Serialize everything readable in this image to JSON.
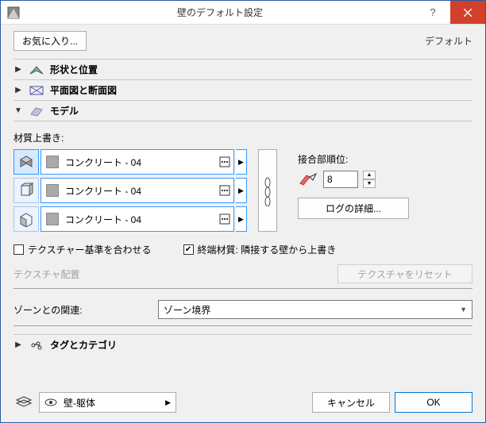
{
  "window": {
    "title": "壁のデフォルト設定"
  },
  "toprow": {
    "favorites": "お気に入り...",
    "default_label": "デフォルト"
  },
  "sections": {
    "shape": "形状と位置",
    "plan": "平面図と断面図",
    "model": "モデル",
    "tags": "タグとカテゴリ"
  },
  "model": {
    "override_label": "材質上書き:",
    "materials": [
      {
        "name": "コンクリート - 04"
      },
      {
        "name": "コンクリート - 04"
      },
      {
        "name": "コンクリート - 04"
      }
    ],
    "junction_label": "接合部順位:",
    "junction_value": "8",
    "log_details": "ログの詳細...",
    "align_texture": "テクスチャー基準を合わせる",
    "end_material": "終端材質: 隣接する壁から上書き",
    "texture_placement": "テクスチャ配置",
    "texture_reset": "テクスチャをリセット",
    "zone_label": "ゾーンとの関連:",
    "zone_value": "ゾーン境界"
  },
  "footer": {
    "layer": "壁-躯体",
    "cancel": "キャンセル",
    "ok": "OK"
  }
}
